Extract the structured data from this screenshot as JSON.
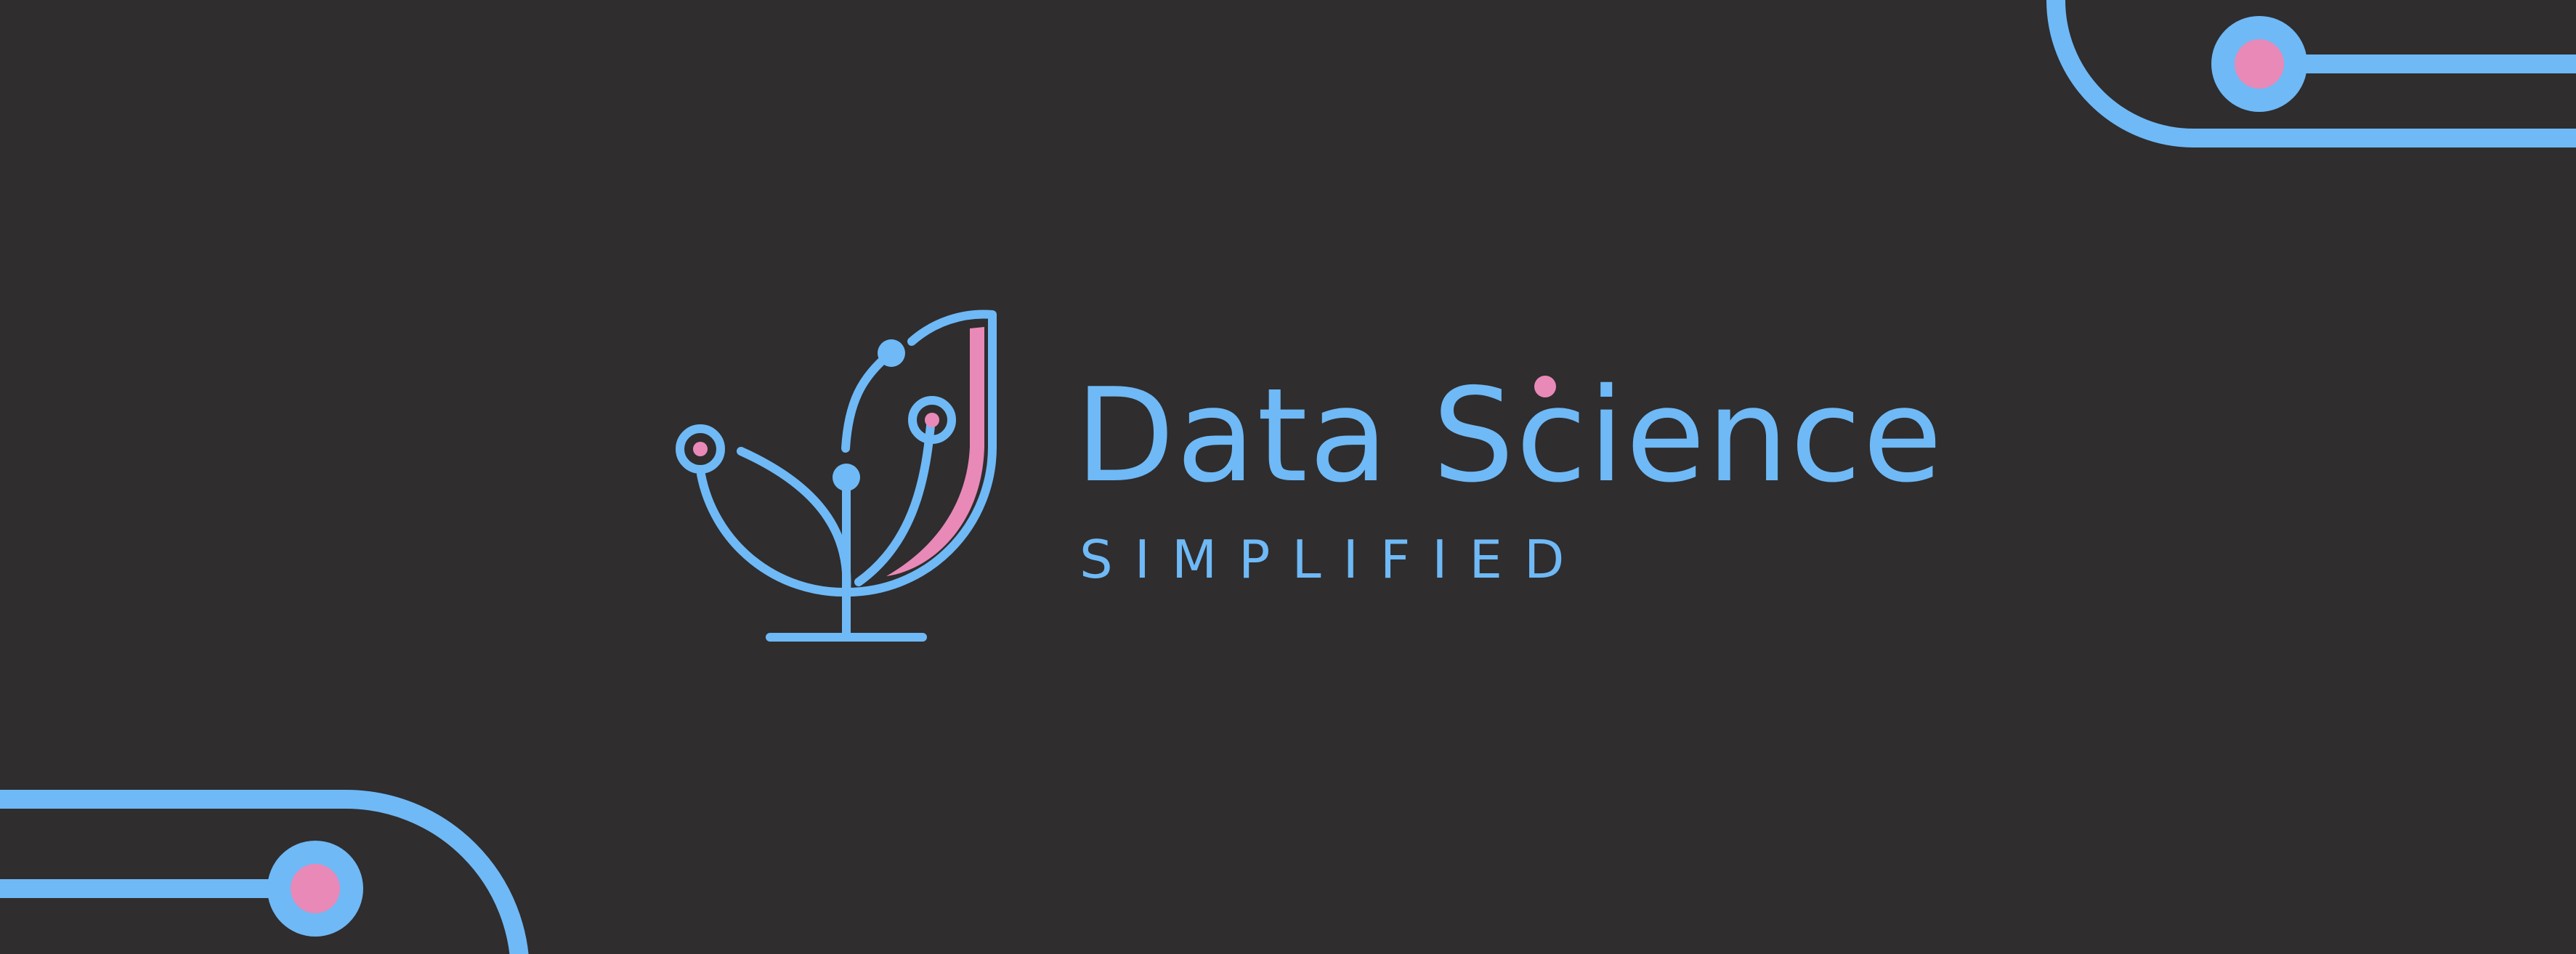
{
  "banner": {
    "title": "Data Science",
    "subtitle": "SIMPLIFIED",
    "icons": {
      "logo": "plant-sprout-icon",
      "decoration": "circuit-trace-icon"
    },
    "colors": {
      "background": "#2f2d2e",
      "primary": "#6fb9f6",
      "accent": "#e889b8"
    }
  }
}
